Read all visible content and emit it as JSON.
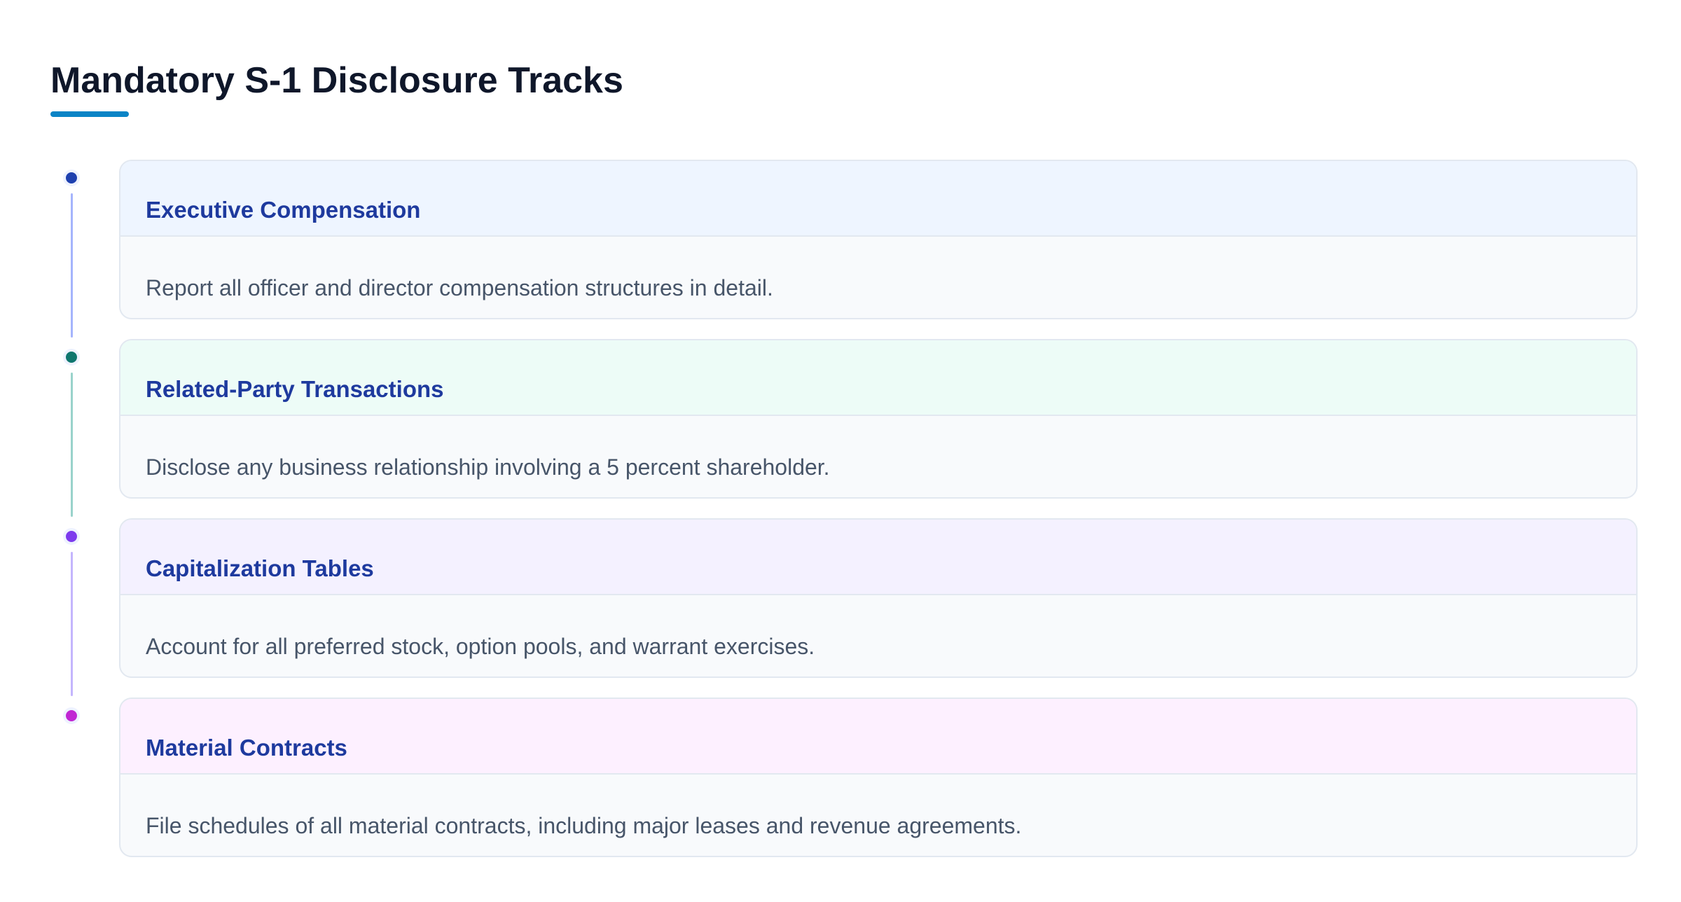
{
  "title": "Mandatory S-1 Disclosure Tracks",
  "colors": {
    "title_accent": "#0b84c6",
    "card_title": "#1e3a9e",
    "description": "#475569"
  },
  "tracks": [
    {
      "title": "Executive Compensation",
      "description": "Report all officer and director compensation structures in detail.",
      "dot_color": "#1e40af",
      "line_color": "#a5b4fc",
      "header_bg": "#eef5ff"
    },
    {
      "title": "Related-Party Transactions",
      "description": "Disclose any business relationship involving a 5 percent shareholder.",
      "dot_color": "#0f766e",
      "line_color": "#99d3cb",
      "header_bg": "#edfcf7"
    },
    {
      "title": "Capitalization Tables",
      "description": "Account for all preferred stock, option pools, and warrant exercises.",
      "dot_color": "#7c3aed",
      "line_color": "#c4b5fd",
      "header_bg": "#f4f1ff"
    },
    {
      "title": "Material Contracts",
      "description": "File schedules of all material contracts, including major leases and revenue agreements.",
      "dot_color": "#c026d3",
      "line_color": "#f0abfc",
      "header_bg": "#fdf0ff"
    }
  ]
}
